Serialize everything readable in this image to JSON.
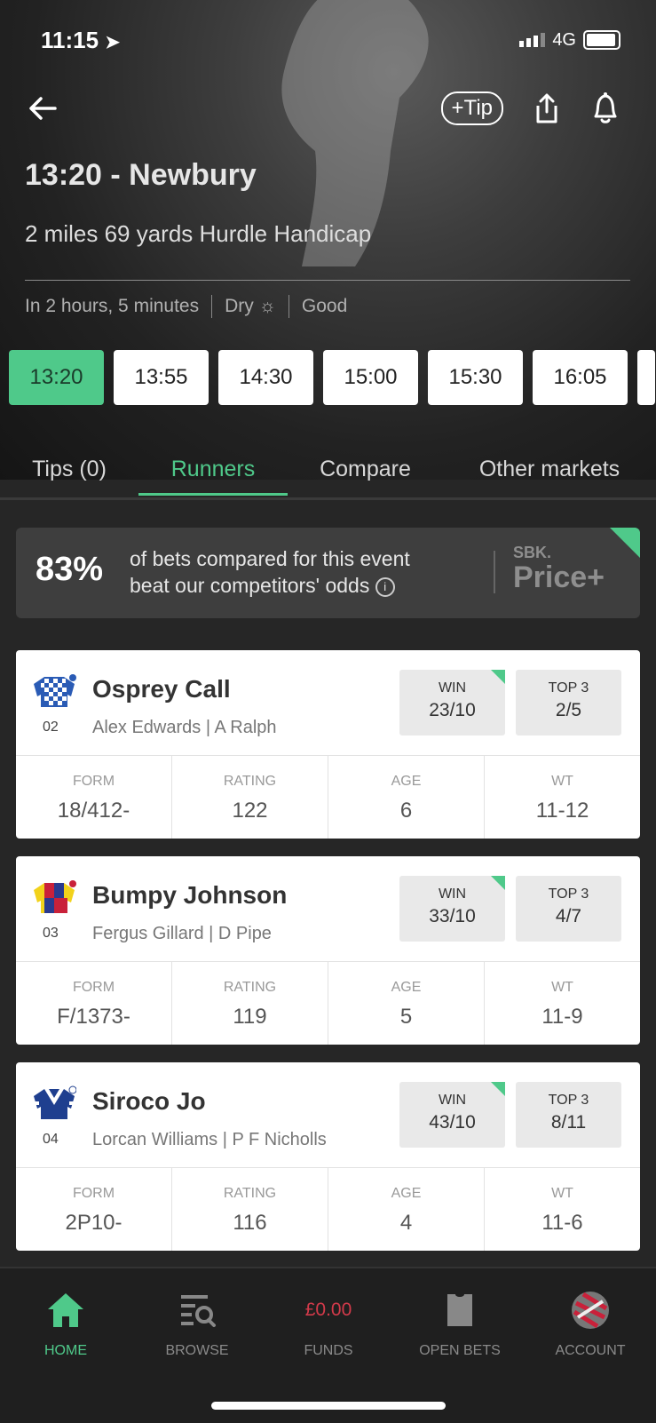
{
  "status_bar": {
    "time": "11:15",
    "network": "4G"
  },
  "header": {
    "tip_label": "+Tip",
    "race_title": "13:20 - Newbury",
    "race_subtitle": "2 miles 69 yards Hurdle Handicap",
    "countdown": "In 2 hours, 5 minutes",
    "weather": "Dry",
    "going": "Good"
  },
  "race_times": [
    {
      "label": "13:20",
      "active": true
    },
    {
      "label": "13:55",
      "active": false
    },
    {
      "label": "14:30",
      "active": false
    },
    {
      "label": "15:00",
      "active": false
    },
    {
      "label": "15:30",
      "active": false
    },
    {
      "label": "16:05",
      "active": false
    }
  ],
  "tabs": [
    {
      "label": "Tips (0)",
      "active": false
    },
    {
      "label": "Runners",
      "active": true
    },
    {
      "label": "Compare",
      "active": false
    },
    {
      "label": "Other markets",
      "active": false
    }
  ],
  "promo": {
    "percent": "83%",
    "line1": "of bets compared for this event",
    "line2": "beat our competitors' odds",
    "brand_small": "SBK.",
    "brand_big": "Price+"
  },
  "stat_labels": {
    "form": "FORM",
    "rating": "RATING",
    "age": "AGE",
    "wt": "WT"
  },
  "odds_labels": {
    "win": "WIN",
    "top3": "TOP 3"
  },
  "runners": [
    {
      "number": "02",
      "name": "Osprey Call",
      "jockey_trainer": "Alex Edwards | A Ralph",
      "win": "23/10",
      "top3": "2/5",
      "form": "18/412-",
      "rating": "122",
      "age": "6",
      "wt": "11-12"
    },
    {
      "number": "03",
      "name": "Bumpy Johnson",
      "jockey_trainer": "Fergus Gillard | D Pipe",
      "win": "33/10",
      "top3": "4/7",
      "form": "F/1373-",
      "rating": "119",
      "age": "5",
      "wt": "11-9"
    },
    {
      "number": "04",
      "name": "Siroco Jo",
      "jockey_trainer": "Lorcan Williams | P F Nicholls",
      "win": "43/10",
      "top3": "8/11",
      "form": "2P10-",
      "rating": "116",
      "age": "4",
      "wt": "11-6"
    }
  ],
  "bottom_nav": {
    "home": "HOME",
    "browse": "BROWSE",
    "funds_value": "£0.00",
    "funds": "FUNDS",
    "open_bets": "OPEN BETS",
    "account": "ACCOUNT"
  },
  "colors": {
    "accent": "#4fc98a",
    "funds": "#d23a4a",
    "background": "#262626"
  }
}
